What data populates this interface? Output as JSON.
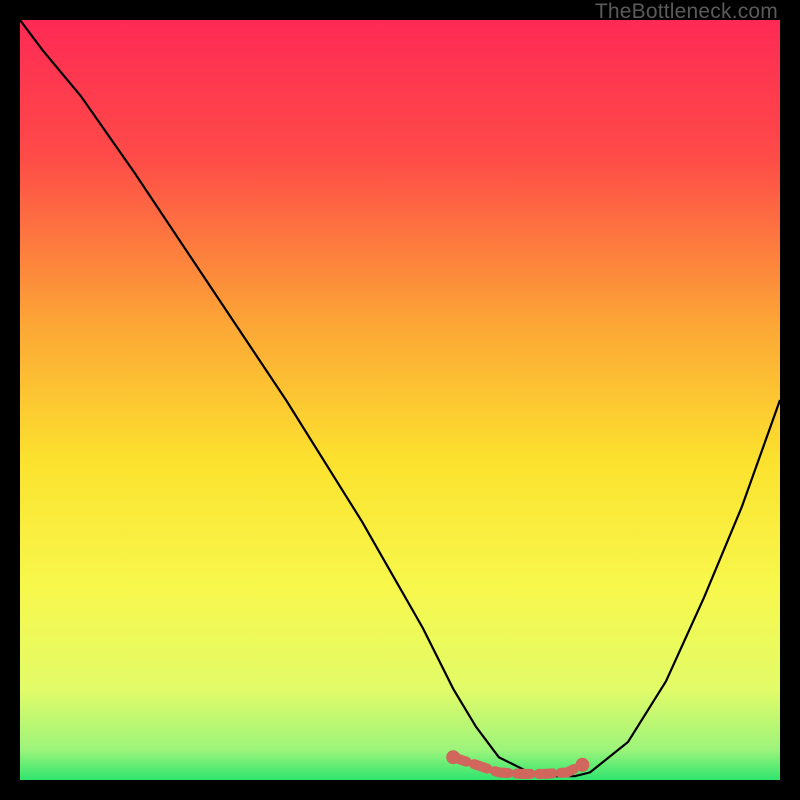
{
  "watermark": "TheBottleneck.com",
  "chart_data": {
    "type": "line",
    "title": "",
    "xlabel": "",
    "ylabel": "",
    "xlim": [
      0,
      100
    ],
    "ylim": [
      0,
      100
    ],
    "series": [
      {
        "name": "curve",
        "x": [
          0,
          3,
          8,
          15,
          25,
          35,
          45,
          53,
          57,
          60,
          63,
          68,
          73,
          75,
          80,
          85,
          90,
          95,
          100
        ],
        "y": [
          100,
          96,
          90,
          80,
          65,
          50,
          34,
          20,
          12,
          7,
          3,
          0.5,
          0.5,
          1,
          5,
          13,
          24,
          36,
          50
        ]
      }
    ],
    "highlight": {
      "name": "optimal-range",
      "color": "#d1675c",
      "x": [
        57,
        60,
        63,
        66,
        69,
        72,
        74
      ],
      "y": [
        3.0,
        2.0,
        1.0,
        0.8,
        0.8,
        1.0,
        2.0
      ]
    },
    "background": {
      "type": "vertical-gradient",
      "stops": [
        {
          "pct": 0,
          "color": "#fe2a55"
        },
        {
          "pct": 18,
          "color": "#fe4b48"
        },
        {
          "pct": 40,
          "color": "#fca636"
        },
        {
          "pct": 58,
          "color": "#fce22e"
        },
        {
          "pct": 75,
          "color": "#f7f84d"
        },
        {
          "pct": 88,
          "color": "#e2fb68"
        },
        {
          "pct": 96,
          "color": "#9df47b"
        },
        {
          "pct": 100,
          "color": "#2ee56e"
        }
      ]
    }
  }
}
